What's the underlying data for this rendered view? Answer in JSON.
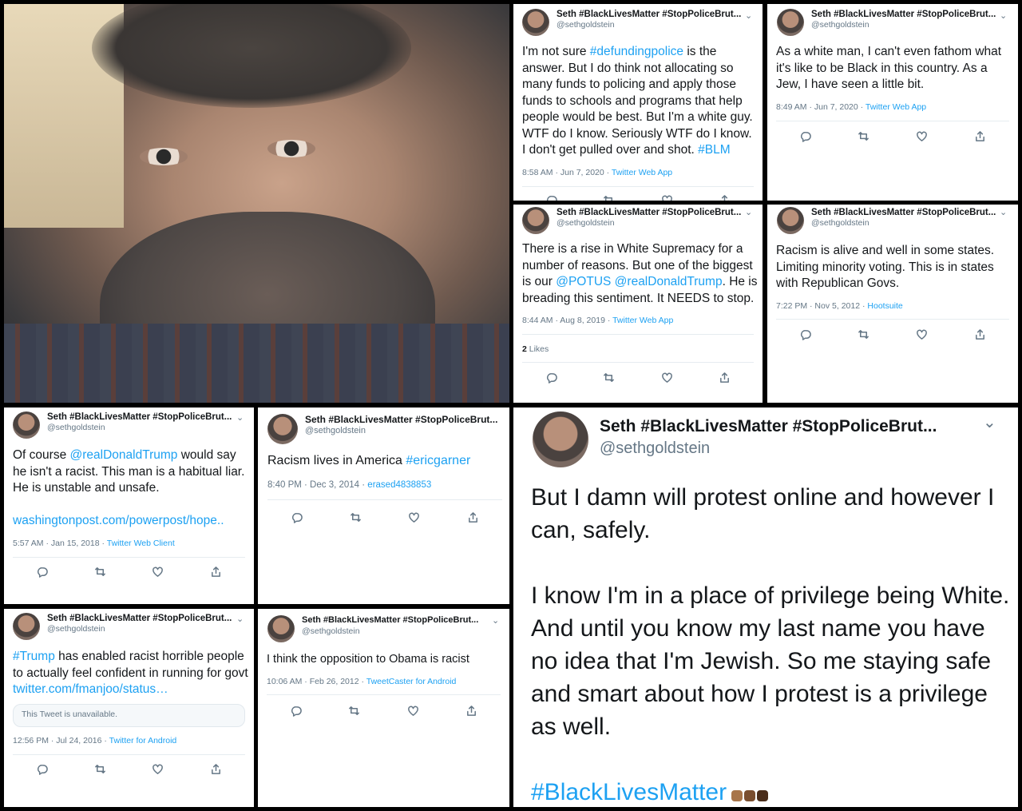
{
  "user": {
    "name": "Seth #BlackLivesMatter #StopPoliceBrut...",
    "handle": "@sethgoldstein"
  },
  "tweets": [
    {
      "segments": [
        {
          "t": "I'm not sure ",
          "c": "text"
        },
        {
          "t": "#defundingpolice",
          "c": "link"
        },
        {
          "t": " is the answer. But I do think not allocating so many funds to policing and apply those funds to schools and programs that help people would be best. But I'm a white guy. WTF do I know. Seriously WTF do I know. I don't get pulled over and shot. ",
          "c": "text"
        },
        {
          "t": "#BLM",
          "c": "link"
        }
      ],
      "time": "8:58 AM · Jun 7, 2020",
      "source": "Twitter Web App"
    },
    {
      "segments": [
        {
          "t": "As a white man, I can't even fathom what it's like to be Black in this country. As a Jew, I have seen a little bit.",
          "c": "text"
        }
      ],
      "time": "8:49 AM · Jun 7, 2020",
      "source": "Twitter Web App"
    },
    {
      "segments": [
        {
          "t": "There is a rise in White Supremacy for a number of reasons. But one of the biggest is our ",
          "c": "text"
        },
        {
          "t": "@POTUS",
          "c": "link"
        },
        {
          "t": " ",
          "c": "text"
        },
        {
          "t": "@realDonaldTrump",
          "c": "link"
        },
        {
          "t": ". He is breading this sentiment. It NEEDS to stop.",
          "c": "text"
        }
      ],
      "time": "8:44 AM · Aug 8, 2019",
      "source": "Twitter Web App",
      "likes_count": "2",
      "likes_label": " Likes"
    },
    {
      "segments": [
        {
          "t": "Racism is alive and well in some states. Limiting minority voting. This is in states with Republican Govs.",
          "c": "text"
        }
      ],
      "time": "7:22 PM · Nov 5, 2012",
      "source": "Hootsuite"
    },
    {
      "segments": [
        {
          "t": "Of course ",
          "c": "text"
        },
        {
          "t": "@realDonaldTrump",
          "c": "link"
        },
        {
          "t": " would say he isn't a racist. This man is a habitual liar. He is unstable and unsafe.",
          "c": "text"
        }
      ],
      "link": "washingtonpost.com/powerpost/hope..",
      "time": "5:57 AM · Jan 15, 2018",
      "source": "Twitter Web Client"
    },
    {
      "segments": [
        {
          "t": "Racism lives in America ",
          "c": "text"
        },
        {
          "t": "#ericgarner",
          "c": "link"
        }
      ],
      "time": "8:40 PM · Dec 3, 2014",
      "source": "erased4838853"
    },
    {
      "segments": [
        {
          "t": "#Trump",
          "c": "link"
        },
        {
          "t": " has enabled racist horrible people to actually feel confident in running for govt ",
          "c": "text"
        },
        {
          "t": "twitter.com/fmanjoo/status…",
          "c": "link"
        }
      ],
      "unavailable": "This Tweet is unavailable.",
      "time": "12:56 PM · Jul 24, 2016",
      "source": "Twitter for Android"
    },
    {
      "segments": [
        {
          "t": "I think the opposition to Obama is racist",
          "c": "text"
        }
      ],
      "time": "10:06 AM · Feb 26, 2012",
      "source": "TweetCaster for Android"
    },
    {
      "segments": [
        {
          "t": "But I damn will protest online and however I can, safely.",
          "c": "text"
        },
        {
          "t": "\n\n",
          "c": "text"
        },
        {
          "t": "I know I'm in a place of privilege being White. And until you know my last name you have no idea that I'm Jewish. So me staying safe and smart about how I protest is a privilege as well.",
          "c": "text"
        },
        {
          "t": "\n\n",
          "c": "text"
        },
        {
          "t": "#BlackLivesMatter",
          "c": "link"
        }
      ]
    }
  ],
  "icons": [
    "reply-icon",
    "retweet-icon",
    "like-icon",
    "share-icon",
    "chevron-down-icon"
  ],
  "colors": {
    "link": "#1da1f2",
    "text": "#14171a",
    "meta": "#657786"
  }
}
